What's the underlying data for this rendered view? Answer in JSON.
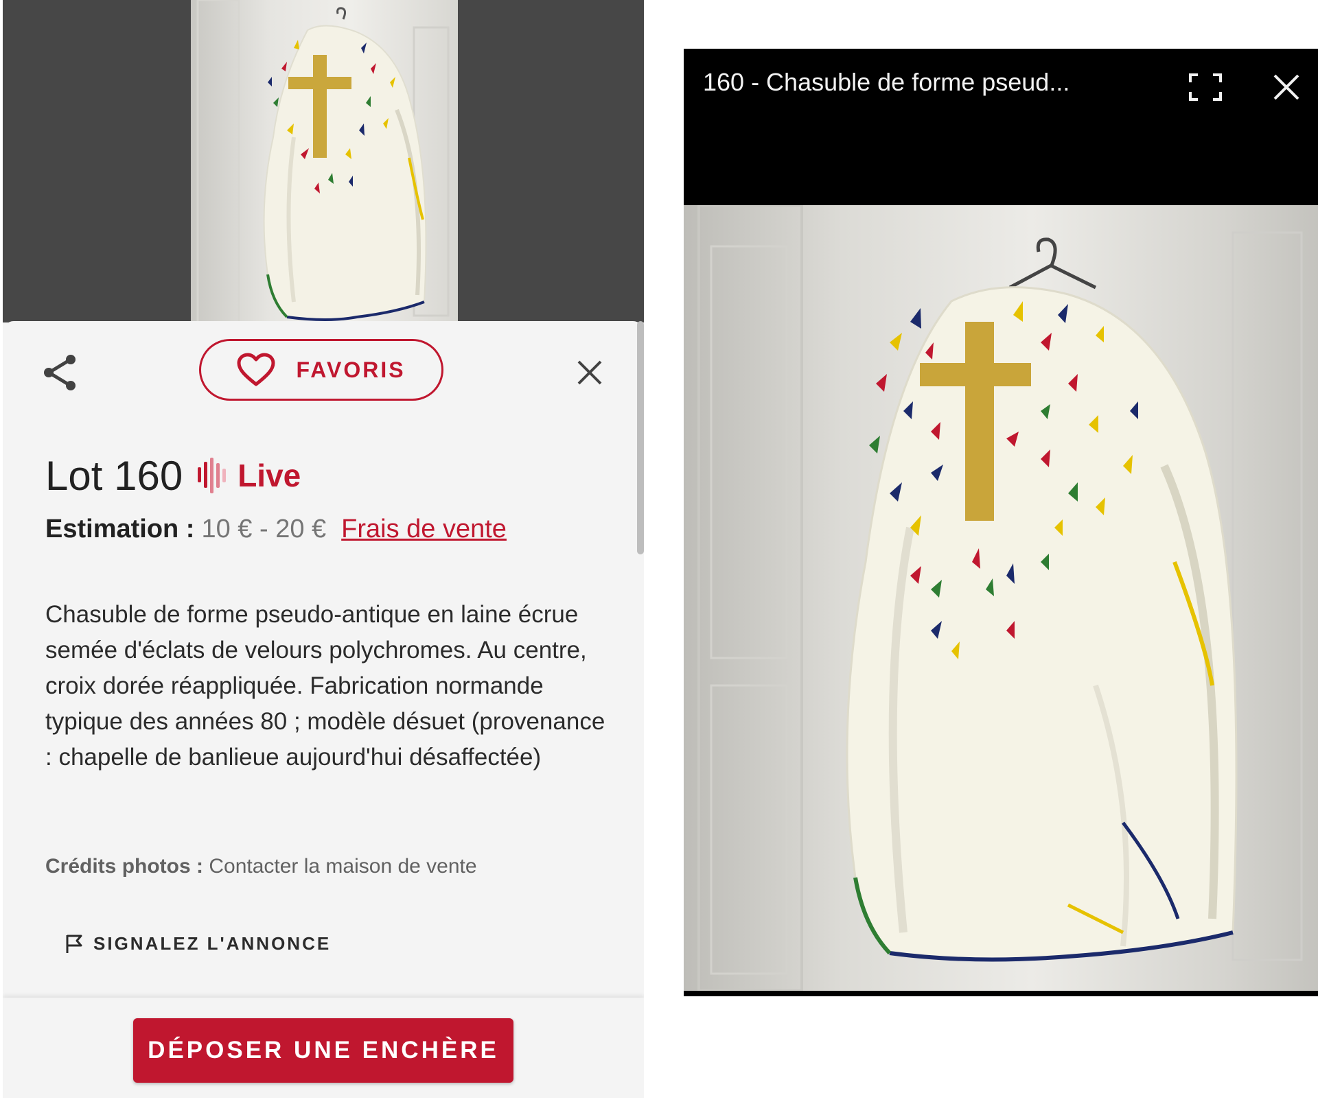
{
  "colors": {
    "accent": "#c0172f",
    "text": "#212121",
    "muted": "#757575",
    "sheet_bg": "#f4f4f4",
    "photo_bg": "#474747"
  },
  "listing": {
    "share_icon": "share-icon",
    "favorite": {
      "icon": "heart-icon",
      "label": "FAVORIS"
    },
    "close_icon": "close-icon",
    "lot_title": "Lot 160",
    "live_icon": "sound-wave-icon",
    "live_label": "Live",
    "estimation_label": "Estimation :",
    "estimation_value": "10 € - 20 €",
    "fees_link": "Frais de vente",
    "description": "Chasuble de forme pseudo-antique en laine écrue semée d'éclats de velours polychromes. Au centre, croix dorée réappliquée. Fabrication normande typique des années 80 ; modèle désuet (provenance : chapelle de banlieue aujourd'hui désaffectée)",
    "credits_label": "Crédits photos :",
    "credits_value": "Contacter la maison de vente",
    "report_icon": "flag-icon",
    "report_label": "SIGNALEZ L'ANNONCE",
    "bid_button": "DÉPOSER UNE ENCHÈRE"
  },
  "viewer": {
    "title": "160 - Chasuble de forme pseud...",
    "fullscreen_icon": "fullscreen-icon",
    "close_icon": "close-icon"
  }
}
